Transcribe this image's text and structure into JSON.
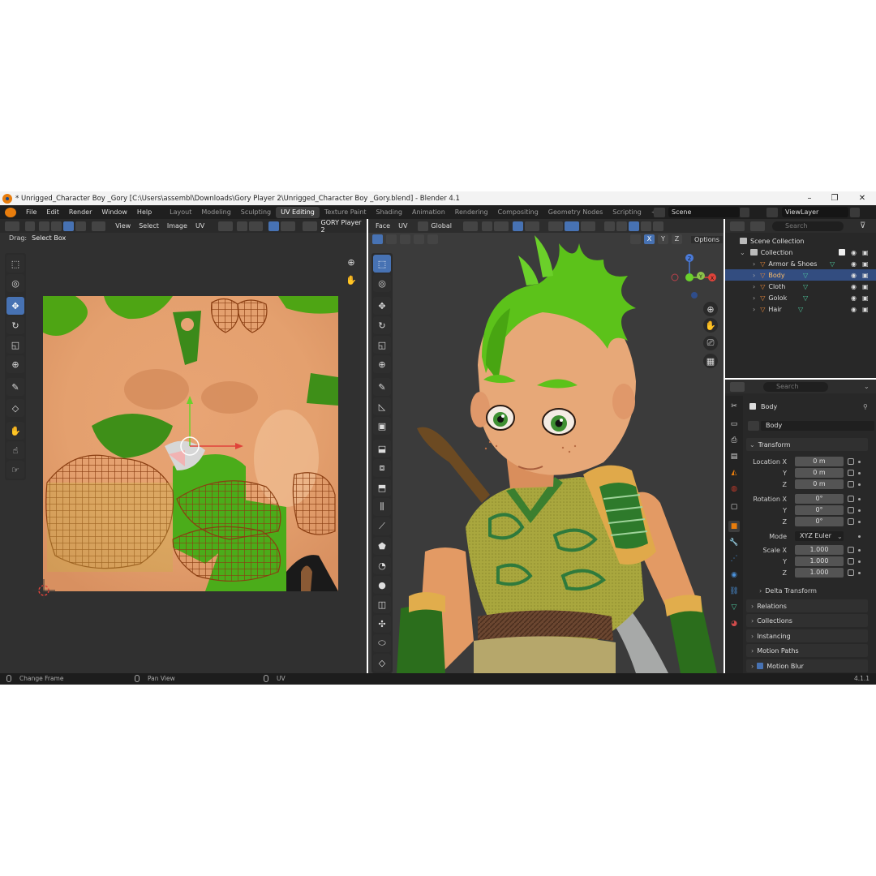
{
  "window": {
    "title": "* Unrigged_Character Boy _Gory [C:\\Users\\assembl\\Downloads\\Gory Player 2\\Unrigged_Character Boy _Gory.blend] - Blender 4.1",
    "minimize": "–",
    "maximize": "❐",
    "close": "✕"
  },
  "menu": {
    "items": [
      "File",
      "Edit",
      "Render",
      "Window",
      "Help"
    ],
    "workspaces": [
      "Layout",
      "Modeling",
      "Sculpting",
      "UV Editing",
      "Texture Paint",
      "Shading",
      "Animation",
      "Rendering",
      "Compositing",
      "Geometry Nodes",
      "Scripting"
    ],
    "active_workspace": "UV Editing",
    "add_tab": "+",
    "scene": "Scene",
    "view_layer": "ViewLayer"
  },
  "uv_editor": {
    "menus": [
      "View",
      "Select",
      "Image",
      "UV"
    ],
    "image_name": "GORY Player 2",
    "drag_label": "Drag:",
    "drag_value": "Select Box"
  },
  "viewport": {
    "menus": [
      "Face",
      "UV"
    ],
    "orientation": "Global",
    "options": "Options",
    "axes": [
      "X",
      "Y",
      "Z"
    ],
    "gizmo": {
      "x": "X",
      "y": "Y",
      "z": "Z"
    }
  },
  "outliner": {
    "search_placeholder": "Search",
    "root": "Scene Collection",
    "collection": "Collection",
    "objects": [
      "Armor & Shoes",
      "Body",
      "Cloth",
      "Golok",
      "Hair"
    ],
    "selected": "Body"
  },
  "properties": {
    "search_placeholder": "Search",
    "object_name": "Body",
    "object_field": "Body",
    "transform_header": "Transform",
    "location_label": "Location X",
    "y_label": "Y",
    "z_label": "Z",
    "location": [
      "0 m",
      "0 m",
      "0 m"
    ],
    "rotation_label": "Rotation X",
    "rotation": [
      "0°",
      "0°",
      "0°"
    ],
    "mode_label": "Mode",
    "mode_value": "XYZ Euler",
    "scale_label": "Scale X",
    "scale": [
      "1.000",
      "1.000",
      "1.000"
    ],
    "delta": "Delta Transform",
    "sections": [
      "Relations",
      "Collections",
      "Instancing",
      "Motion Paths",
      "Motion Blur"
    ]
  },
  "statusbar": {
    "left": "Change Frame",
    "middle": "Pan View",
    "right": "UV",
    "version": "4.1.1"
  },
  "colors": {
    "accent": "#4772b3",
    "selected_row": "#334d80",
    "hair_green": "#5cc21a",
    "skin": "#e7a878"
  }
}
